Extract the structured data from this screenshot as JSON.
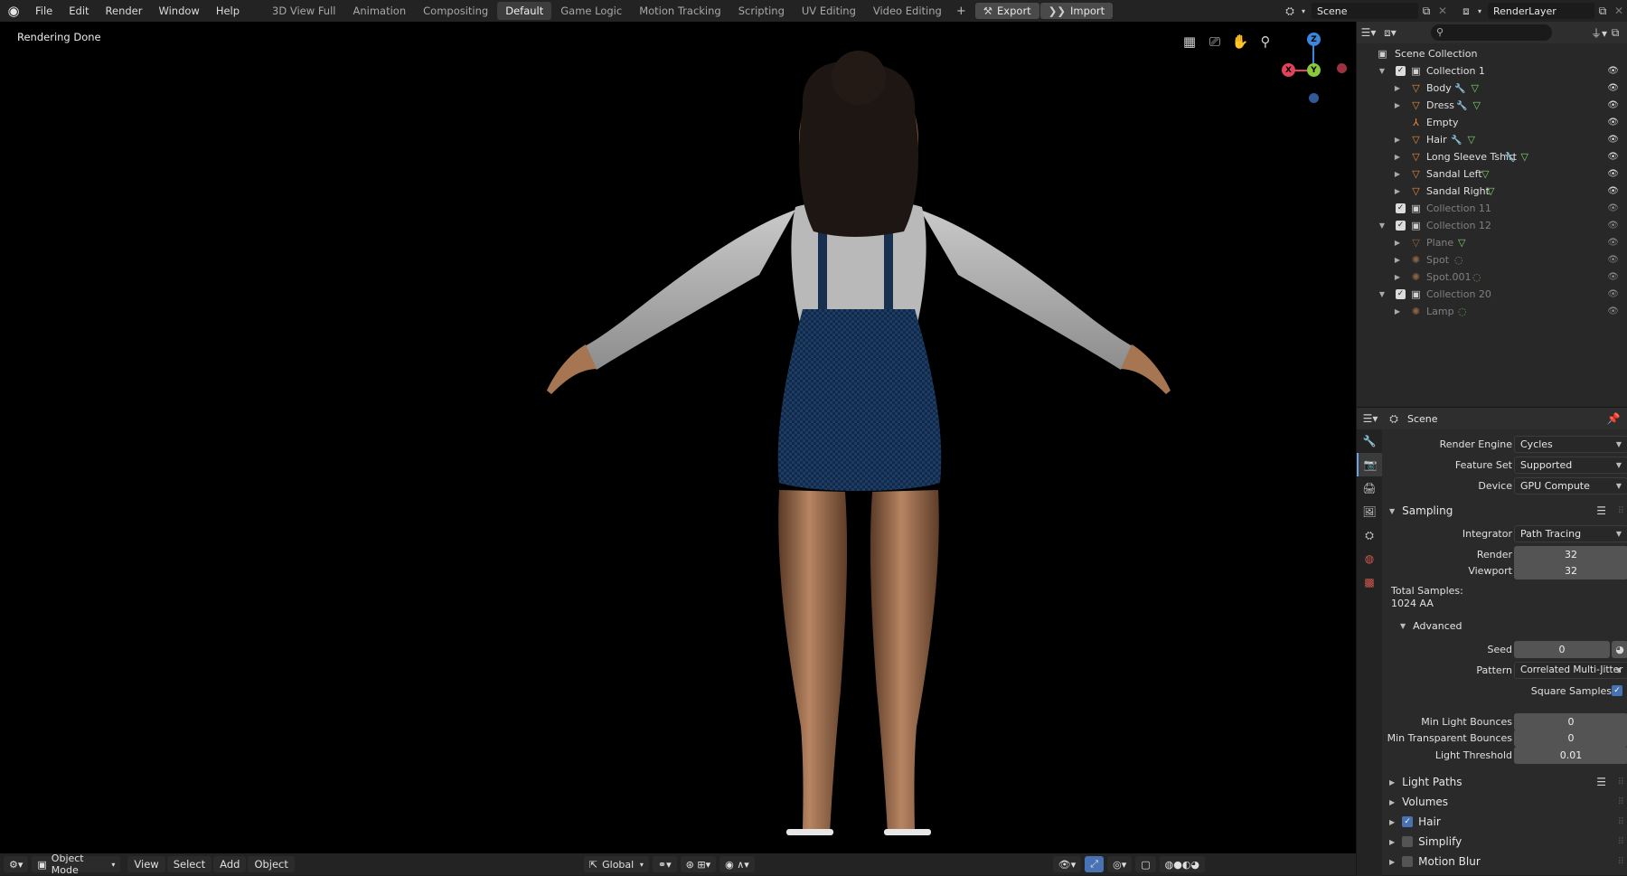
{
  "topbar": {
    "menus": [
      "File",
      "Edit",
      "Render",
      "Window",
      "Help"
    ],
    "workspaces": [
      "3D View Full",
      "Animation",
      "Compositing",
      "Default",
      "Game Logic",
      "Motion Tracking",
      "Scripting",
      "UV Editing",
      "Video Editing"
    ],
    "active_workspace": "Default",
    "add_workspace": "+",
    "export_label": "Export",
    "import_label": "Import",
    "scene_name": "Scene",
    "view_layer": "RenderLayer"
  },
  "viewport": {
    "status": "Rendering Done",
    "gizmo": {
      "z": "Z",
      "y": "Y",
      "x": "X"
    }
  },
  "bottombar": {
    "mode": "Object Mode",
    "menus": [
      "View",
      "Select",
      "Add",
      "Object"
    ],
    "transform_orientation": "Global"
  },
  "outliner": {
    "search_placeholder": "",
    "root": "Scene Collection",
    "rows": [
      {
        "label": "Collection 1",
        "dim": false
      },
      {
        "label": "Body",
        "dim": false
      },
      {
        "label": "Dress",
        "dim": false
      },
      {
        "label": "Empty",
        "dim": false
      },
      {
        "label": "Hair",
        "dim": false
      },
      {
        "label": "Long Sleeve Tshirt",
        "dim": false
      },
      {
        "label": "Sandal Left",
        "dim": false
      },
      {
        "label": "Sandal Right",
        "dim": false
      },
      {
        "label": "Collection 11",
        "dim": true
      },
      {
        "label": "Collection 12",
        "dim": true
      },
      {
        "label": "Plane",
        "dim": true
      },
      {
        "label": "Spot",
        "dim": true
      },
      {
        "label": "Spot.001",
        "dim": true
      },
      {
        "label": "Collection 20",
        "dim": true
      },
      {
        "label": "Lamp",
        "dim": true
      }
    ]
  },
  "properties": {
    "context": "Scene",
    "render_engine": {
      "label": "Render Engine",
      "value": "Cycles"
    },
    "feature_set": {
      "label": "Feature Set",
      "value": "Supported"
    },
    "device": {
      "label": "Device",
      "value": "GPU Compute"
    },
    "sampling": {
      "title": "Sampling",
      "integrator": {
        "label": "Integrator",
        "value": "Path Tracing"
      },
      "render": {
        "label": "Render",
        "value": "32"
      },
      "viewport": {
        "label": "Viewport",
        "value": "32"
      },
      "total_samples_label": "Total Samples:",
      "total_samples_value": "1024 AA",
      "advanced": {
        "title": "Advanced",
        "seed": {
          "label": "Seed",
          "value": "0"
        },
        "pattern": {
          "label": "Pattern",
          "value": "Correlated Multi-Jitter"
        },
        "square_samples": {
          "label": "Square Samples",
          "checked": true
        },
        "min_light_bounces": {
          "label": "Min Light Bounces",
          "value": "0"
        },
        "min_transparent_bounces": {
          "label": "Min Transparent Bounces",
          "value": "0"
        },
        "light_threshold": {
          "label": "Light Threshold",
          "value": "0.01"
        }
      }
    },
    "panels": [
      {
        "title": "Light Paths",
        "checkbox": null
      },
      {
        "title": "Volumes",
        "checkbox": null
      },
      {
        "title": "Hair",
        "checkbox": true
      },
      {
        "title": "Simplify",
        "checkbox": false
      },
      {
        "title": "Motion Blur",
        "checkbox": false
      }
    ]
  },
  "colors": {
    "accent": "#4772b3",
    "mesh_icon": "#e8883a",
    "modifier_icon": "#6fa0e8",
    "data_icon": "#7fd36b",
    "axis_x": "#e3435a",
    "axis_y": "#8ac83e",
    "axis_z": "#3d86de"
  }
}
